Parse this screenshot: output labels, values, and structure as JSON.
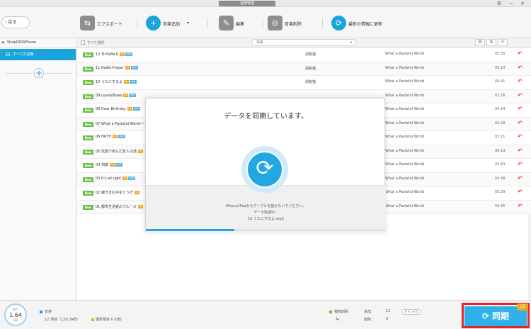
{
  "window": {
    "title": "音楽管理",
    "settings_icon": "gear-icon",
    "minimize": "−",
    "close": "×"
  },
  "toolbar": {
    "back_label": "戻る",
    "export_label": "エクスポート",
    "add_music_label": "音楽追加",
    "edit_label": "編集",
    "delete_label": "音楽削除",
    "refresh_label": "最新の情報に更新"
  },
  "sidebar": {
    "device_name": "ShopDDDiPhone",
    "items": [
      {
        "label": "すべての音楽"
      }
    ]
  },
  "list": {
    "select_all": "すべて選択",
    "search_placeholder": "検索",
    "rows": [
      {
        "badge": "New",
        "title": "12 日々WALK",
        "q": "SQ",
        "fmt": "MP3",
        "artist": "胡桃猫",
        "album": "What a Pastaful World",
        "time": "05:55"
      },
      {
        "badge": "New",
        "title": "11 Radio Prayer",
        "q": "SQ",
        "fmt": "MP3",
        "artist": "胡桃猫",
        "album": "What a Pastaful World",
        "time": "05:10"
      },
      {
        "badge": "New",
        "title": "10 うたにするよ",
        "q": "SQ",
        "fmt": "MP3",
        "artist": "胡桃猫",
        "album": "What a Pastaful World",
        "time": "04:41"
      },
      {
        "badge": "New",
        "title": "09 Love&Blues",
        "q": "SQ",
        "fmt": "MP3",
        "artist": "",
        "album": "What a Pastaful World",
        "time": "03:26"
      },
      {
        "badge": "New",
        "title": "08 Dear Birthday",
        "q": "SQ",
        "fmt": "MP3",
        "artist": "",
        "album": "What a Pastaful World",
        "time": "04:24"
      },
      {
        "badge": "New",
        "title": "07 What a Pastaful World～",
        "q": "",
        "fmt": "",
        "artist": "",
        "album": "What a Pastaful World",
        "time": "04:28"
      },
      {
        "badge": "New",
        "title": "06 FAITH",
        "q": "SQ",
        "fmt": "MP3",
        "artist": "",
        "album": "What a Pastaful World",
        "time": "03:21"
      },
      {
        "badge": "New",
        "title": "05 咒詛で死んだ友人の話",
        "q": "SQ",
        "fmt": "",
        "artist": "",
        "album": "What a Pastaful World",
        "time": "06:19"
      },
      {
        "badge": "New",
        "title": "04 刻都",
        "q": "SQ",
        "fmt": "MP3",
        "artist": "",
        "album": "What a Pastaful World",
        "time": "03:43"
      },
      {
        "badge": "New",
        "title": "03 It's all right",
        "q": "SQ",
        "fmt": "MP3",
        "artist": "",
        "album": "What a Pastaful World",
        "time": "04:38"
      },
      {
        "badge": "New",
        "title": "02 瘰ぎまお手をどうぞ",
        "q": "SQ",
        "fmt": "",
        "artist": "",
        "album": "What a Pastaful World",
        "time": "05:29"
      },
      {
        "badge": "New",
        "title": "01 都市生活者のブルース",
        "q": "SQ",
        "fmt": "",
        "artist": "",
        "album": "What a Pastaful World",
        "time": "04:45"
      }
    ]
  },
  "dialog": {
    "title": "データを同期しています。",
    "line1": "iPhone/iPadからケーブルを抜かないでください。",
    "line2": "データ転送中...",
    "line3": "10 うたにするよ.mp3",
    "progress": 0.37
  },
  "footer": {
    "storage_label": "残り",
    "storage_value": "1.64",
    "storage_unit": "GB",
    "music_label": "音楽",
    "items_text": "12 項目（129.2MB）",
    "selected_text": "選択項目 0 (0B)",
    "deleted_legend": "複数削除",
    "added_label": "追加：",
    "added_value": "12",
    "removed_label": "削除：",
    "removed_value": "0",
    "cancel_label": "キャンセル",
    "sync_label": "同期",
    "sync_count": "12",
    "colors": {
      "accent": "#1ba4dc",
      "new_badge": "#6cc04a",
      "undo": "#e64038",
      "highlight": "#e8232b"
    }
  }
}
